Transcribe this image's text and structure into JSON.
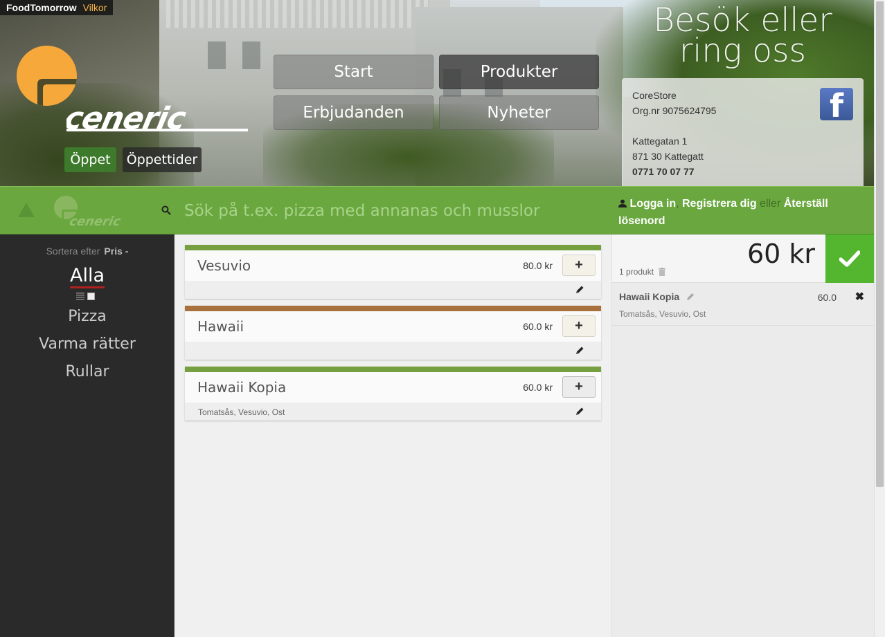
{
  "topbar": {
    "brand": "FoodTomorrow",
    "terms": "Vilkor"
  },
  "hero": {
    "open_label": "Öppet",
    "hours_label": "Öppettider",
    "nav": [
      "Start",
      "Produkter",
      "Erbjudanden",
      "Nyheter"
    ],
    "visit_line1": "Besök eller",
    "visit_line2": "ring oss",
    "contact": {
      "company": "CoreStore",
      "org": "Org.nr 9075624795",
      "street": "Kattegatan 1",
      "city": "871 30 Kattegatt",
      "phone": "0771 70 07 77"
    },
    "facebook_glyph": "f"
  },
  "search": {
    "placeholder": "Sök på t.ex. pizza med annanas och musslor"
  },
  "auth": {
    "login": "Logga in",
    "register": "Registrera dig",
    "or": "eller",
    "reset": "Återställ lösenord"
  },
  "sidebar": {
    "sort_label": "Sortera efter",
    "sort_value": "Pris -",
    "categories": [
      "Alla",
      "Pizza",
      "Varma rätter",
      "Rullar"
    ]
  },
  "products": [
    {
      "name": "Vesuvio",
      "price": "80.0 kr",
      "ingredients": "",
      "stripe_color": "#76a040"
    },
    {
      "name": "Hawaii",
      "price": "60.0 kr",
      "ingredients": "",
      "stripe_color": "#a8703c"
    },
    {
      "name": "Hawaii Kopia",
      "price": "60.0 kr",
      "ingredients": "Tomatsås,  Vesuvio,  Ost",
      "stripe_color": "#76a040"
    }
  ],
  "add_label": "+",
  "cart": {
    "total": "60 kr",
    "count": "1 produkt",
    "items": [
      {
        "name": "Hawaii Kopia",
        "price": "60.0",
        "ingredients": "Tomatsås,  Vesuvio,  Ost",
        "remove": "✖"
      }
    ]
  },
  "colors": {
    "green_bar": "#6aa83f",
    "checkout": "#54b52f",
    "accent_orange": "#f7a83a",
    "open_green": "#3e7a2c"
  }
}
